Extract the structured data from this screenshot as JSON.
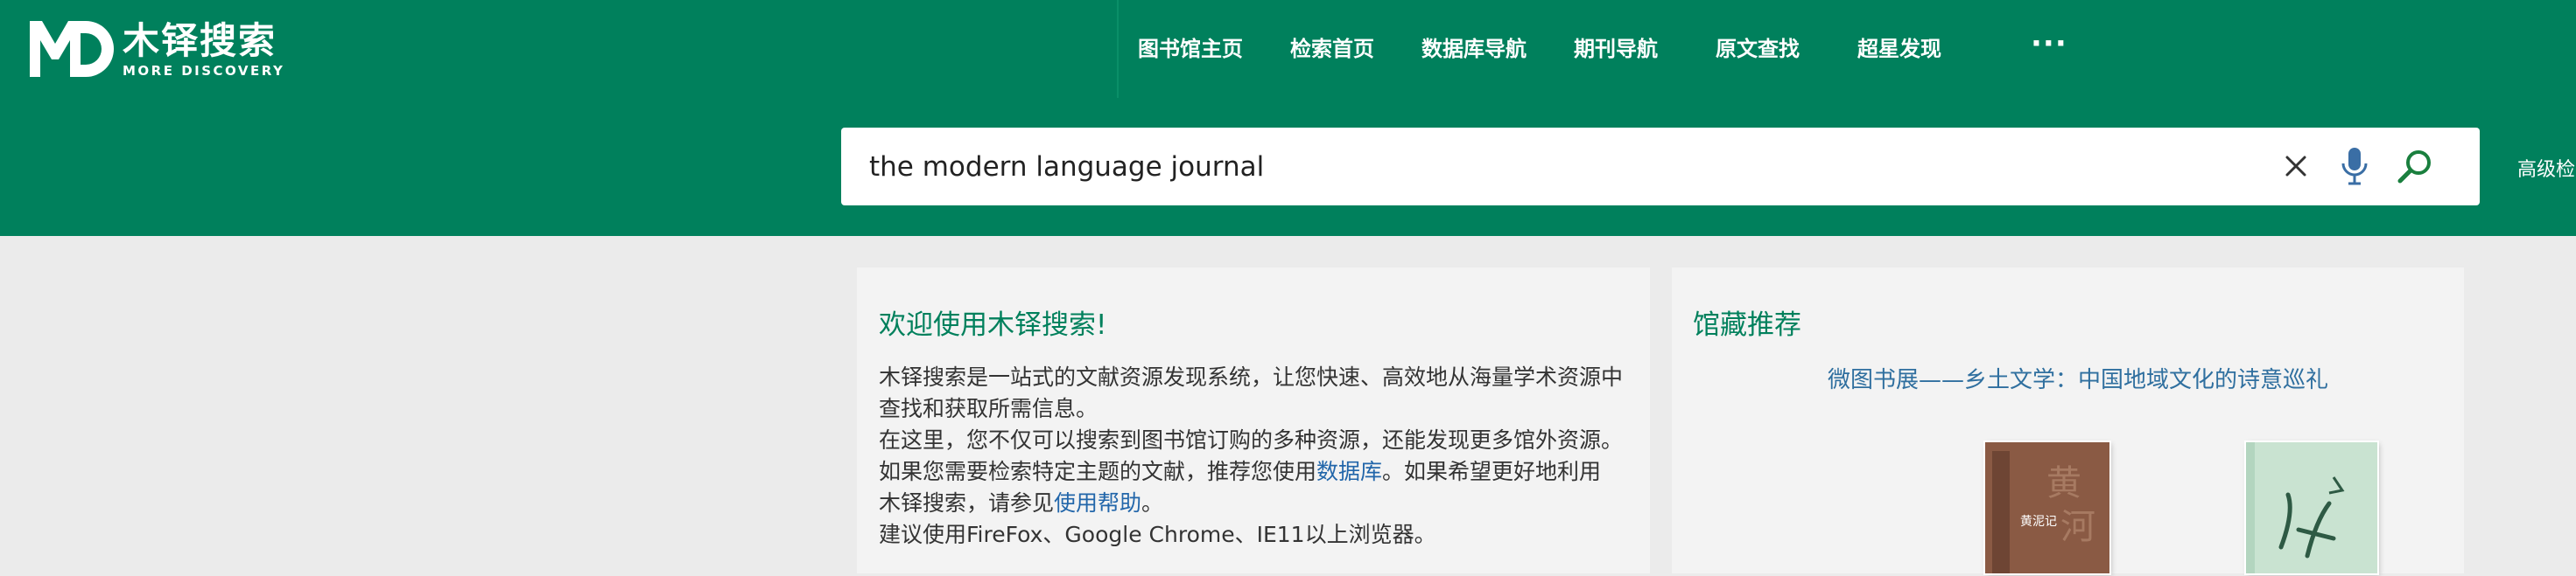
{
  "header": {
    "logo": {
      "cn": "木铎搜索",
      "en": "MORE DISCOVERY"
    },
    "nav": [
      {
        "label": "图书馆主页"
      },
      {
        "label": "检索首页"
      },
      {
        "label": "数据库导航"
      },
      {
        "label": "期刊导航"
      },
      {
        "label": "原文查找"
      },
      {
        "label": "超星发现"
      }
    ],
    "more_label": "···"
  },
  "search": {
    "value": "the modern language journal",
    "advanced_label": "高级检"
  },
  "welcome": {
    "title": "欢迎使用木铎搜索!",
    "line1": "木铎搜索是一站式的文献资源发现系统，让您快速、高效地从海量学术资源中查找和获取所需信息。",
    "line2": "在这里，您不仅可以搜索到图书馆订购的多种资源，还能发现更多馆外资源。",
    "line3_prefix": "如果您需要检索特定主题的文献，推荐您使用",
    "line3_link": "数据库",
    "line3_mid": "。如果希望更好地利用木铎搜索，请参见",
    "line3_link2": "使用帮助",
    "line3_suffix": "。",
    "line4": "建议使用FireFox、Google Chrome、IE11以上浏览器。"
  },
  "recommend": {
    "title": "馆藏推荐",
    "link": "微图书展——乡土文学：中国地域文化的诗意巡礼",
    "books": [
      {
        "cover_color": "#8a5a44",
        "spine_text": "黄泥记"
      },
      {
        "cover_color": "#c9e3d1",
        "spine_text": ""
      }
    ]
  }
}
